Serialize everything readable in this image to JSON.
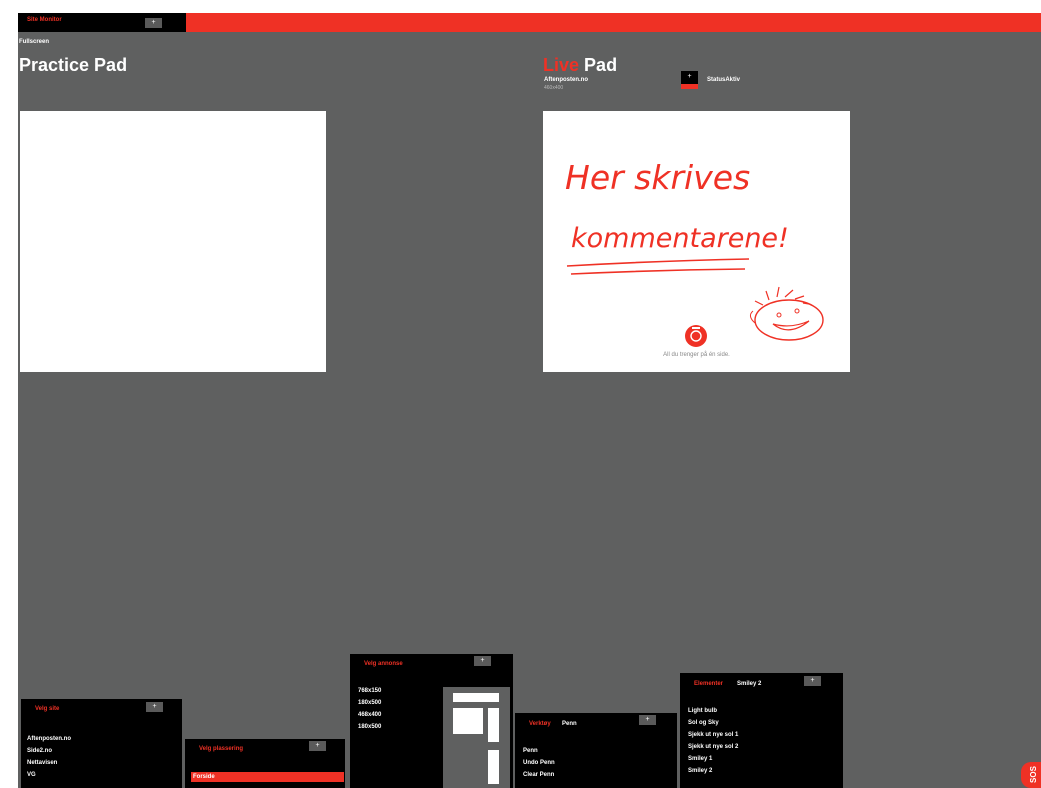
{
  "topbar": {
    "title": "Site Monitor",
    "toggle": "+"
  },
  "fullscreen_label": "Fullscreen",
  "practice": {
    "heading": "Practice Pad"
  },
  "live": {
    "heading_accent": "Live",
    "heading_rest": "Pad",
    "site": "Aftenposten.no",
    "size": "460x400",
    "status_toggle": "+",
    "status_label": "StatusAktiv",
    "handwriting": [
      "Her skrives",
      "kommentarene!"
    ],
    "tagline": "All du trenger på én side."
  },
  "panels": {
    "site": {
      "title": "Velg site",
      "toggle": "+",
      "items": [
        "Aftenposten.no",
        "Side2.no",
        "Nettavisen",
        "VG"
      ]
    },
    "placement": {
      "title": "Velg plassering",
      "toggle": "+",
      "items": [
        "Forside"
      ],
      "selected": "Forside"
    },
    "ad": {
      "title": "Velg annonse",
      "toggle": "+",
      "items": [
        "768x150",
        "180x500",
        "468x400",
        "180x500"
      ]
    },
    "tool": {
      "title": "Verktøy",
      "selected": "Penn",
      "toggle": "+",
      "items": [
        "Penn",
        "Undo Penn",
        "Clear Penn"
      ]
    },
    "elements": {
      "title": "Elementer",
      "selected": "Smiley 2",
      "toggle": "+",
      "items": [
        "Light bulb",
        "Sol og Sky",
        "Sjekk ut nye sol 1",
        "Sjekk ut nye sol 2",
        "Smiley 1",
        "Smiley 2"
      ]
    }
  },
  "badge": {
    "text": "SOS"
  },
  "colors": {
    "accent": "#ef3125",
    "background": "#5f6060",
    "panel": "#000000"
  }
}
